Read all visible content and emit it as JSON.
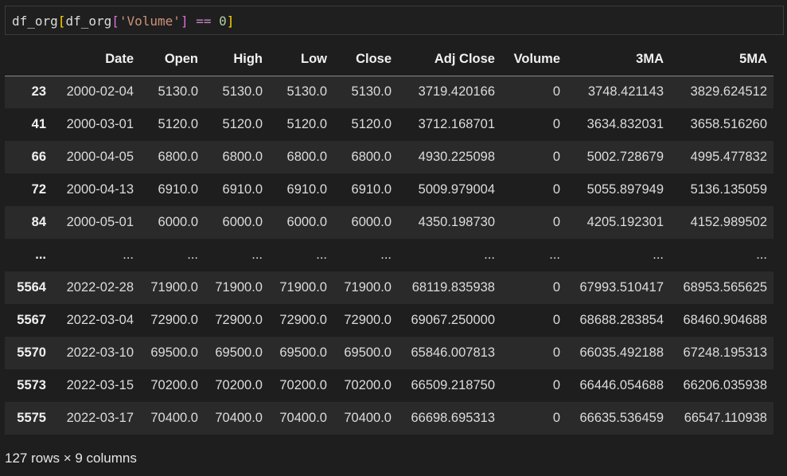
{
  "code": {
    "var1": "df_org",
    "br_open": "[",
    "var2": "df_org",
    "br2_open": "[",
    "str": "'Volume'",
    "br2_close": "]",
    "op": "==",
    "num": "0",
    "br_close": "]"
  },
  "table": {
    "columns": [
      "",
      "Date",
      "Open",
      "High",
      "Low",
      "Close",
      "Adj Close",
      "Volume",
      "3MA",
      "5MA"
    ],
    "rows": [
      [
        "23",
        "2000-02-04",
        "5130.0",
        "5130.0",
        "5130.0",
        "5130.0",
        "3719.420166",
        "0",
        "3748.421143",
        "3829.624512"
      ],
      [
        "41",
        "2000-03-01",
        "5120.0",
        "5120.0",
        "5120.0",
        "5120.0",
        "3712.168701",
        "0",
        "3634.832031",
        "3658.516260"
      ],
      [
        "66",
        "2000-04-05",
        "6800.0",
        "6800.0",
        "6800.0",
        "6800.0",
        "4930.225098",
        "0",
        "5002.728679",
        "4995.477832"
      ],
      [
        "72",
        "2000-04-13",
        "6910.0",
        "6910.0",
        "6910.0",
        "6910.0",
        "5009.979004",
        "0",
        "5055.897949",
        "5136.135059"
      ],
      [
        "84",
        "2000-05-01",
        "6000.0",
        "6000.0",
        "6000.0",
        "6000.0",
        "4350.198730",
        "0",
        "4205.192301",
        "4152.989502"
      ],
      [
        "...",
        "...",
        "...",
        "...",
        "...",
        "...",
        "...",
        "...",
        "...",
        "..."
      ],
      [
        "5564",
        "2022-02-28",
        "71900.0",
        "71900.0",
        "71900.0",
        "71900.0",
        "68119.835938",
        "0",
        "67993.510417",
        "68953.565625"
      ],
      [
        "5567",
        "2022-03-04",
        "72900.0",
        "72900.0",
        "72900.0",
        "72900.0",
        "69067.250000",
        "0",
        "68688.283854",
        "68460.904688"
      ],
      [
        "5570",
        "2022-03-10",
        "69500.0",
        "69500.0",
        "69500.0",
        "69500.0",
        "65846.007813",
        "0",
        "66035.492188",
        "67248.195313"
      ],
      [
        "5573",
        "2022-03-15",
        "70200.0",
        "70200.0",
        "70200.0",
        "70200.0",
        "66509.218750",
        "0",
        "66446.054688",
        "66206.035938"
      ],
      [
        "5575",
        "2022-03-17",
        "70400.0",
        "70400.0",
        "70400.0",
        "70400.0",
        "66698.695313",
        "0",
        "66635.536459",
        "66547.110938"
      ]
    ]
  },
  "summary": "127 rows × 9 columns"
}
